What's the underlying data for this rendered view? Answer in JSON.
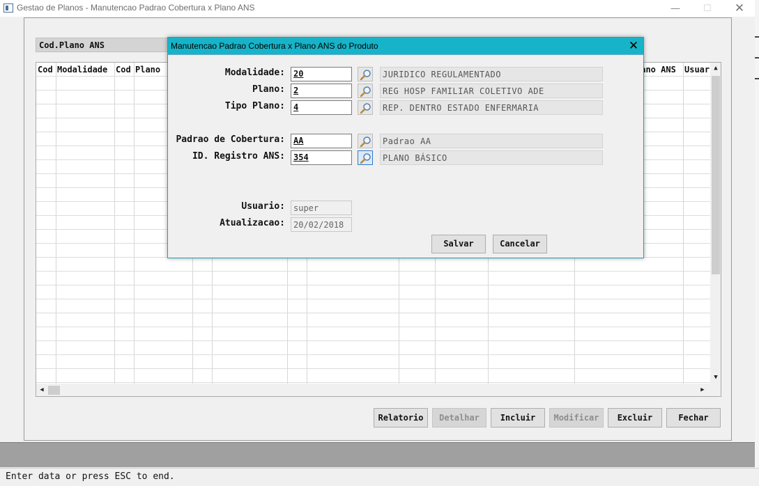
{
  "window": {
    "title": "Gestao de Planos - Manutencao Padrao Cobertura x Plano ANS",
    "controls": {
      "minimize": "—",
      "maximize": "☐",
      "close": "✕"
    }
  },
  "search": {
    "label": "Cod.Plano ANS"
  },
  "grid": {
    "columns": [
      "Cod",
      "Modalidade",
      "Cod",
      "Plano",
      "lano ANS",
      "Usuar"
    ],
    "scroll": {
      "up": "▲",
      "down": "▼",
      "left": "◀",
      "right": "▶"
    }
  },
  "toolbar": {
    "relatorio": "Relatorio",
    "detalhar": "Detalhar",
    "incluir": "Incluir",
    "modificar": "Modificar",
    "excluir": "Excluir",
    "fechar": "Fechar"
  },
  "status": {
    "text": "Enter data or press ESC to end."
  },
  "dialog": {
    "title": "Manutencao Padrao Cobertura x Plano ANS do Produto",
    "close": "✕",
    "fields": {
      "modalidade": {
        "label": "Modalidade:",
        "value": "20",
        "desc": "JURIDICO REGULAMENTADO"
      },
      "plano": {
        "label": "Plano:",
        "value": "2",
        "desc": "REG HOSP FAMILIAR COLETIVO ADE"
      },
      "tipo_plano": {
        "label": "Tipo Plano:",
        "value": "4",
        "desc": "REP. DENTRO ESTADO ENFERMARIA"
      },
      "padrao_cobertura": {
        "label": "Padrao de Cobertura:",
        "value": "AA",
        "desc": "Padrao AA"
      },
      "id_registro_ans": {
        "label": "ID. Registro ANS:",
        "value": "354",
        "desc": "PLANO BÁSICO"
      },
      "usuario": {
        "label": "Usuario:",
        "value": "super"
      },
      "atualizacao": {
        "label": "Atualizacao:",
        "value": "20/02/2018"
      }
    },
    "buttons": {
      "salvar": "Salvar",
      "cancelar": "Cancelar"
    }
  },
  "colors": {
    "dialog_titlebar": "#17b3c8",
    "status_strip": "#a0a0a0"
  }
}
